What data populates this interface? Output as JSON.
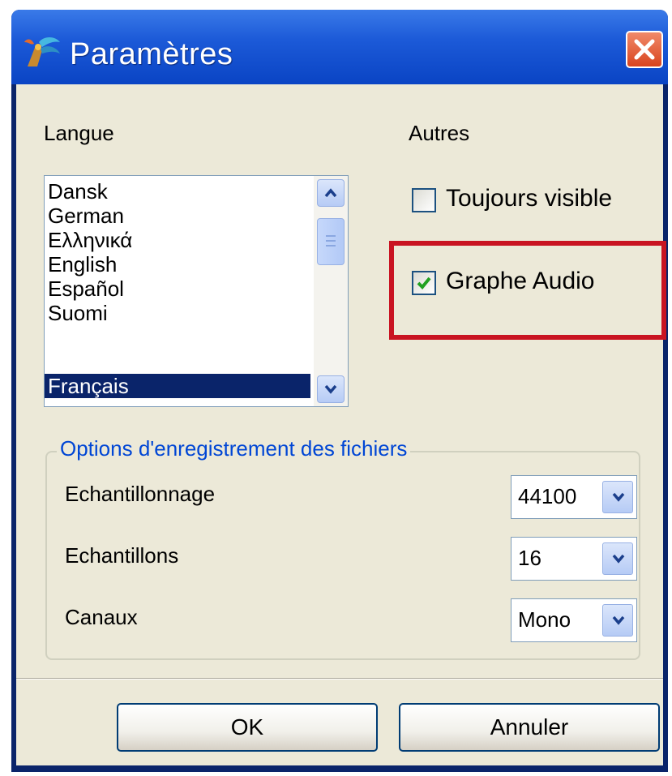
{
  "window": {
    "title": "Paramètres"
  },
  "language": {
    "label": "Langue",
    "items": [
      "Dansk",
      "German",
      "Ελληνικά",
      "English",
      "Español",
      "Suomi",
      "Français"
    ],
    "selected": "Français"
  },
  "others": {
    "label": "Autres",
    "always_visible": {
      "label": "Toujours visible",
      "checked": false
    },
    "audio_graph": {
      "label": "Graphe Audio",
      "checked": true
    }
  },
  "file_options": {
    "title": "Options d'enregistrement des fichiers",
    "sampling_rate": {
      "label": "Echantillonnage",
      "value": "44100"
    },
    "samples": {
      "label": "Echantillons",
      "value": "16"
    },
    "channels": {
      "label": "Canaux",
      "value": "Mono"
    }
  },
  "buttons": {
    "ok": "OK",
    "cancel": "Annuler"
  },
  "colors": {
    "titlebar": "#0a44c4",
    "selection": "#0a246a",
    "highlight_box": "#c91422",
    "group_title": "#0046d5"
  },
  "icons": {
    "app": "settings-app-icon",
    "close": "close-icon"
  }
}
